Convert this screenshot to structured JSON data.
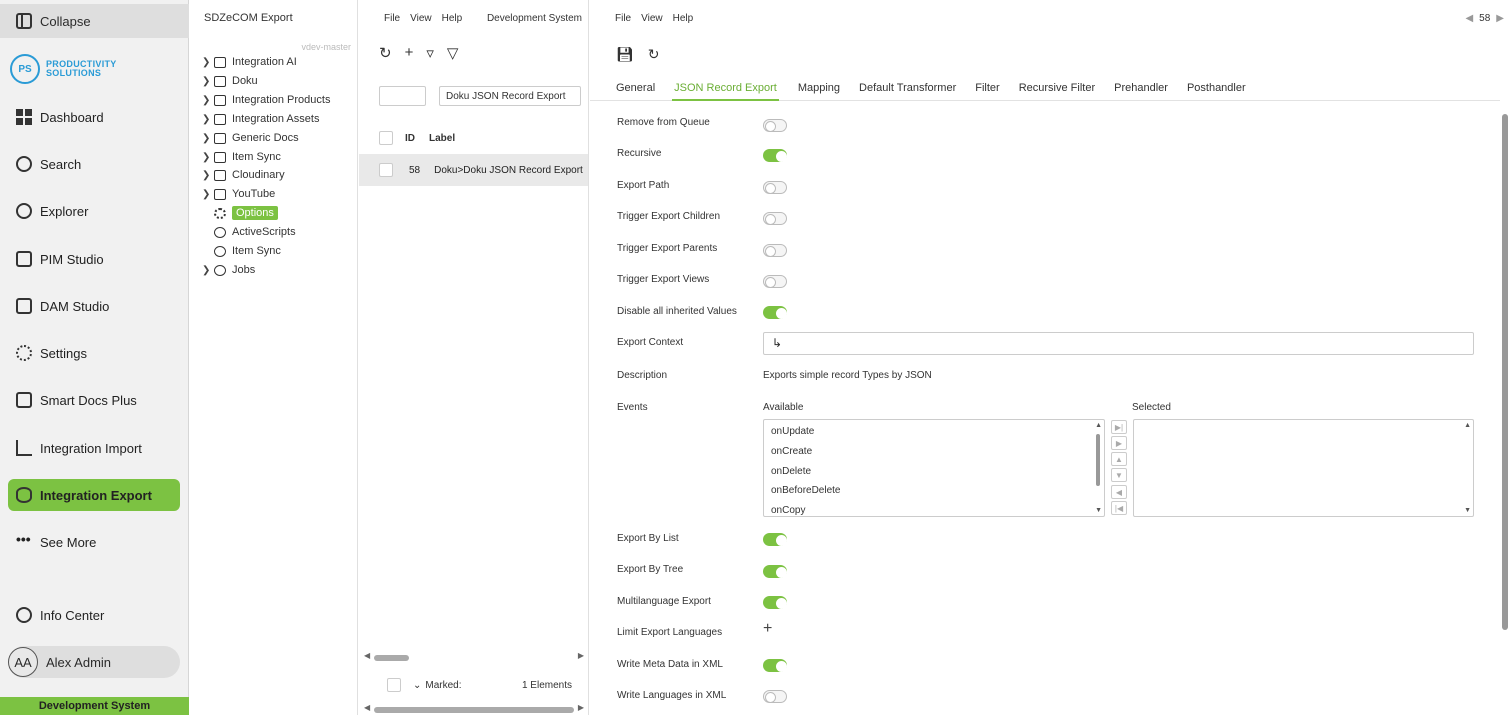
{
  "nav": {
    "collapse": "Collapse",
    "logo_initials": "PS",
    "logo_line1": "PRODUCTIVITY",
    "logo_line2": "SOLUTIONS",
    "items": [
      {
        "label": "Dashboard",
        "icon": "dashboard-icon"
      },
      {
        "label": "Search",
        "icon": "search-icon"
      },
      {
        "label": "Explorer",
        "icon": "explorer-icon"
      },
      {
        "label": "PIM Studio",
        "icon": "pim-icon"
      },
      {
        "label": "DAM Studio",
        "icon": "image-icon"
      },
      {
        "label": "Settings",
        "icon": "gear-icon"
      },
      {
        "label": "Smart Docs Plus",
        "icon": "document-icon"
      },
      {
        "label": "Integration Import",
        "icon": "import-icon"
      },
      {
        "label": "Integration Export",
        "icon": "export-icon",
        "active": true
      },
      {
        "label": "See More",
        "icon": "more-icon"
      }
    ],
    "info_center": "Info Center",
    "user_initials": "AA",
    "user_name": "Alex Admin",
    "environment": "Development System",
    "accent": "#7cc242"
  },
  "tree": {
    "title": "SDZeCOM Export",
    "branch": "vdev-master",
    "items": [
      {
        "label": "Integration AI",
        "expandable": true
      },
      {
        "label": "Doku",
        "expandable": true
      },
      {
        "label": "Integration Products",
        "expandable": true
      },
      {
        "label": "Integration Assets",
        "expandable": true
      },
      {
        "label": "Generic Docs",
        "expandable": true
      },
      {
        "label": "Item Sync",
        "expandable": true
      },
      {
        "label": "Cloudinary",
        "expandable": true
      },
      {
        "label": "YouTube",
        "expandable": true
      },
      {
        "label": "Options",
        "expandable": false,
        "selected": true
      },
      {
        "label": "ActiveScripts",
        "expandable": false
      },
      {
        "label": "Item Sync",
        "expandable": false
      },
      {
        "label": "Jobs",
        "expandable": true
      }
    ]
  },
  "list": {
    "menu": [
      "File",
      "View",
      "Help"
    ],
    "environment": "Development System",
    "filter_label_value": "Doku JSON Record Export",
    "col_id": "ID",
    "col_label": "Label",
    "rows": [
      {
        "id": "58",
        "label": "Doku>Doku JSON Record Export"
      }
    ],
    "marked_label": "Marked:",
    "elements_count": "1 Elements"
  },
  "detail": {
    "menu": [
      "File",
      "View",
      "Help"
    ],
    "record_id": "58",
    "tabs": [
      "General",
      "JSON Record Export",
      "Mapping",
      "Default Transformer",
      "Filter",
      "Recursive Filter",
      "Prehandler",
      "Posthandler"
    ],
    "active_tab": "JSON Record Export",
    "fields": {
      "remove_from_queue": {
        "label": "Remove from Queue",
        "on": false
      },
      "recursive": {
        "label": "Recursive",
        "on": true
      },
      "export_path": {
        "label": "Export Path",
        "on": false
      },
      "trigger_children": {
        "label": "Trigger Export Children",
        "on": false
      },
      "trigger_parents": {
        "label": "Trigger Export Parents",
        "on": false
      },
      "trigger_views": {
        "label": "Trigger Export Views",
        "on": false
      },
      "disable_inherited": {
        "label": "Disable all inherited Values",
        "on": true
      },
      "export_by_list": {
        "label": "Export By List",
        "on": true
      },
      "export_by_tree": {
        "label": "Export By Tree",
        "on": true
      },
      "multilanguage": {
        "label": "Multilanguage Export",
        "on": true
      },
      "write_meta": {
        "label": "Write Meta Data in XML",
        "on": true
      },
      "write_languages": {
        "label": "Write Languages in XML",
        "on": false
      }
    },
    "export_context_label": "Export Context",
    "description_label": "Description",
    "description_value": "Exports simple record Types by JSON",
    "events_label": "Events",
    "available_label": "Available",
    "selected_label": "Selected",
    "available_events": [
      "onUpdate",
      "onCreate",
      "onDelete",
      "onBeforeDelete",
      "onCopy"
    ],
    "limit_languages_label": "Limit Export Languages"
  }
}
